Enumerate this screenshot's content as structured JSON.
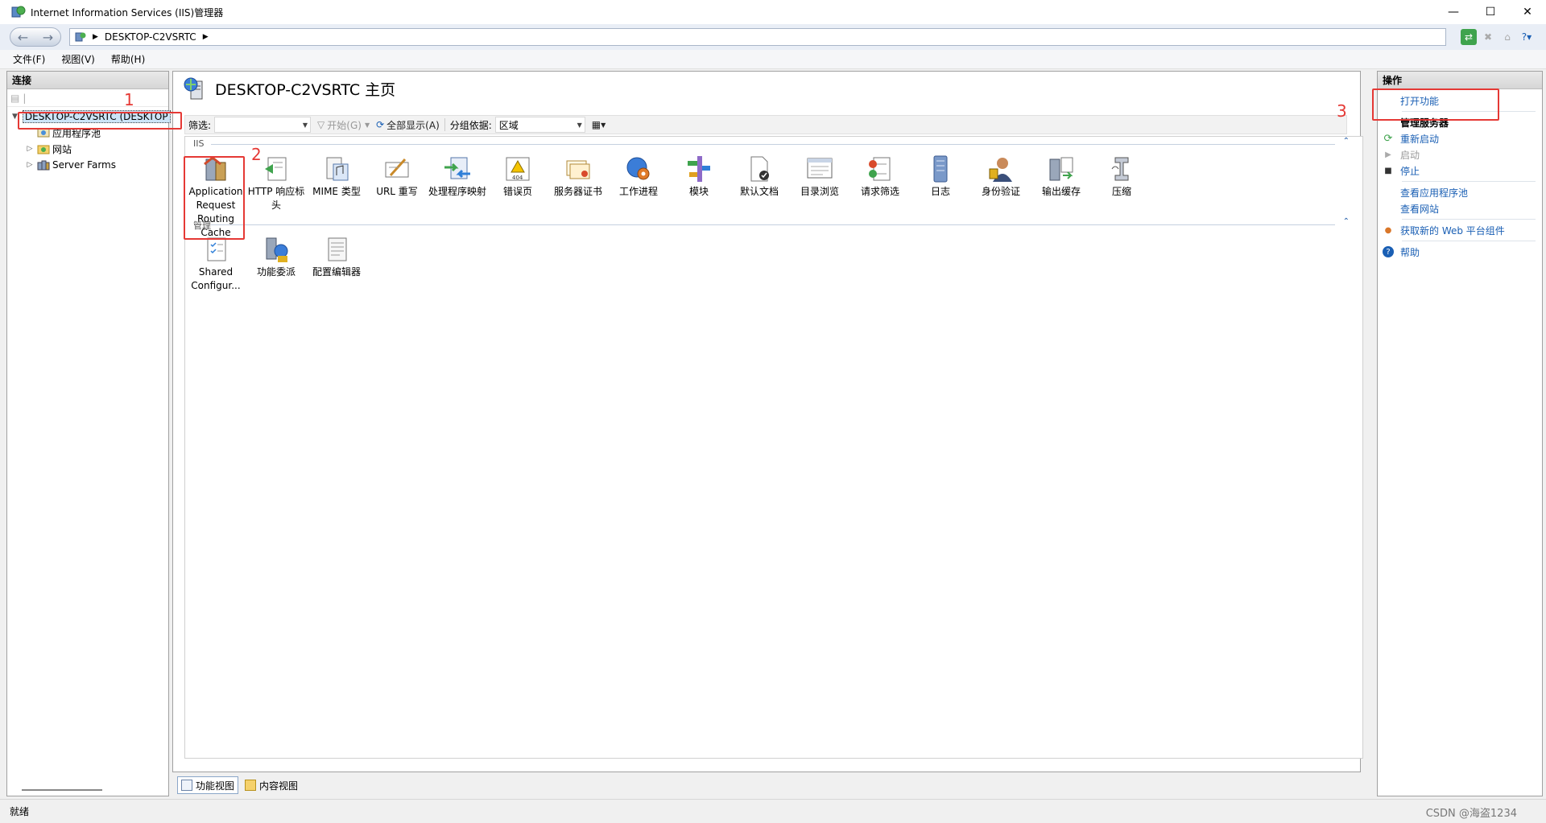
{
  "window": {
    "title": "Internet Information Services (IIS)管理器"
  },
  "address": {
    "path": "DESKTOP-C2VSRTC"
  },
  "menu": [
    "文件(F)",
    "视图(V)",
    "帮助(H)"
  ],
  "connections": {
    "title": "连接",
    "tree": {
      "server": "DESKTOP-C2VSRTC (DESKTOP",
      "children": [
        "应用程序池",
        "网站",
        "Server Farms"
      ]
    }
  },
  "main": {
    "heading": "DESKTOP-C2VSRTC 主页",
    "filter": {
      "label": "筛选:",
      "start": "开始(G)",
      "showall": "全部显示(A)",
      "groupby": "分组依据:",
      "group_value": "区域"
    },
    "group_iis": "IIS",
    "features_iis": [
      {
        "label": "Application Request Routing Cache",
        "icon": "arr-cache-icon"
      },
      {
        "label": "HTTP 响应标头",
        "icon": "http-headers-icon"
      },
      {
        "label": "MIME 类型",
        "icon": "mime-types-icon"
      },
      {
        "label": "URL 重写",
        "icon": "url-rewrite-icon"
      },
      {
        "label": "处理程序映射",
        "icon": "handler-mappings-icon"
      },
      {
        "label": "错误页",
        "icon": "error-pages-icon"
      },
      {
        "label": "服务器证书",
        "icon": "server-certificates-icon"
      },
      {
        "label": "工作进程",
        "icon": "worker-processes-icon"
      },
      {
        "label": "模块",
        "icon": "modules-icon"
      },
      {
        "label": "默认文档",
        "icon": "default-document-icon"
      },
      {
        "label": "目录浏览",
        "icon": "directory-browsing-icon"
      },
      {
        "label": "请求筛选",
        "icon": "request-filtering-icon"
      },
      {
        "label": "日志",
        "icon": "logging-icon"
      },
      {
        "label": "身份验证",
        "icon": "authentication-icon"
      },
      {
        "label": "输出缓存",
        "icon": "output-caching-icon"
      },
      {
        "label": "压缩",
        "icon": "compression-icon"
      }
    ],
    "group_manage": "管理",
    "features_manage": [
      {
        "label": "Shared Configur...",
        "icon": "shared-config-icon"
      },
      {
        "label": "功能委派",
        "icon": "feature-delegation-icon"
      },
      {
        "label": "配置编辑器",
        "icon": "config-editor-icon"
      }
    ]
  },
  "bottom_tabs": [
    "功能视图",
    "内容视图"
  ],
  "actions": {
    "title": "操作",
    "items": [
      {
        "label": "打开功能",
        "type": "link"
      },
      {
        "label": "管理服务器",
        "type": "head"
      },
      {
        "label": "重新启动",
        "type": "link",
        "icon": "restart-icon"
      },
      {
        "label": "启动",
        "type": "disabled",
        "icon": "start-icon"
      },
      {
        "label": "停止",
        "type": "link",
        "icon": "stop-icon"
      },
      {
        "label": "查看应用程序池",
        "type": "link"
      },
      {
        "label": "查看网站",
        "type": "link"
      },
      {
        "label": "获取新的 Web 平台组件",
        "type": "link",
        "icon": "web-platform-icon"
      },
      {
        "label": "帮助",
        "type": "link",
        "icon": "help-icon"
      }
    ]
  },
  "status": "就绪",
  "watermark": "CSDN @海盗1234",
  "annotations": [
    "1",
    "2",
    "3"
  ],
  "colors": {
    "annotation": "#e53935",
    "link": "#1a5fb4",
    "selection": "#cce4f7"
  }
}
